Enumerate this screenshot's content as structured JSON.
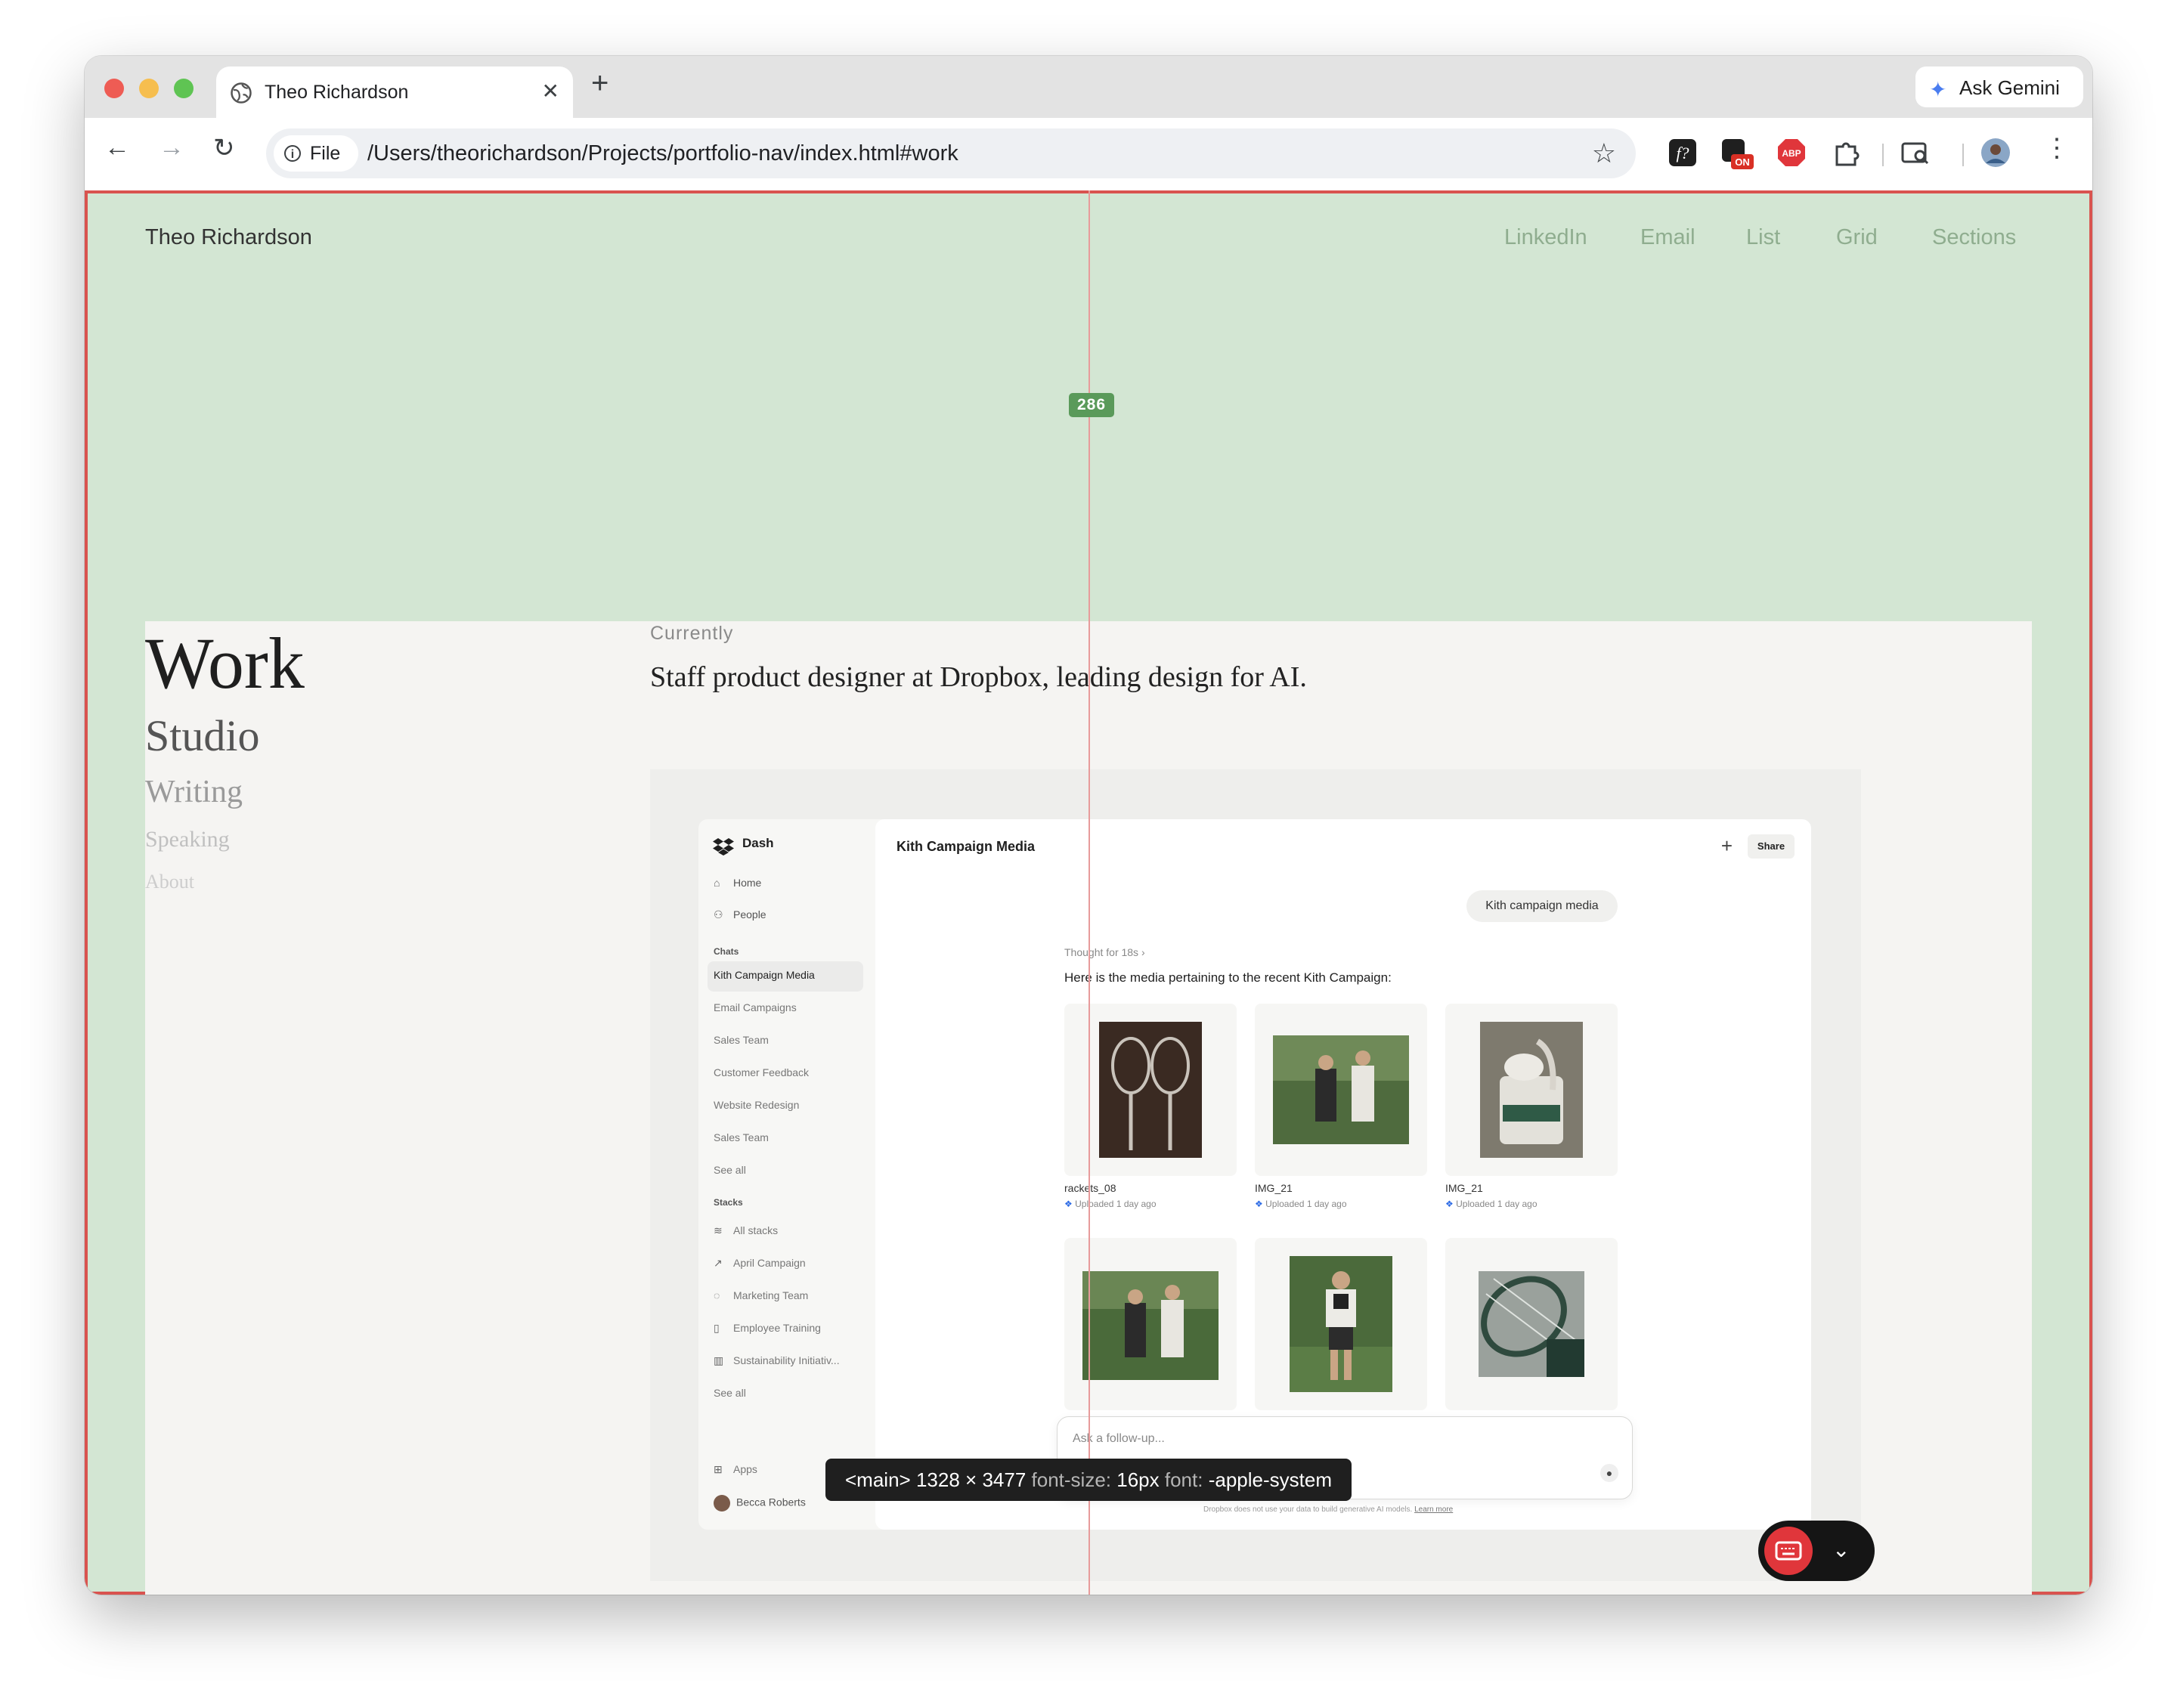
{
  "browser": {
    "tab_title": "Theo Richardson",
    "tab_close": "✕",
    "new_tab": "+",
    "gemini_label": "Ask Gemini",
    "back": "←",
    "forward": "→",
    "reload": "↻",
    "chip_label": "File",
    "url": "/Users/theorichardson/Projects/portfolio-nav/index.html#work",
    "ext_on_badge": "ON",
    "ext_abp": "ABP"
  },
  "site": {
    "name": "Theo Richardson",
    "nav": [
      "LinkedIn",
      "Email",
      "List",
      "Grid",
      "Sections"
    ]
  },
  "overlay": {
    "measure_value": "286",
    "inspector_tag": "<main>",
    "inspector_size": "1328 × 3477",
    "inspector_fs_label": "font-size:",
    "inspector_fs": "16px",
    "inspector_font_label": "font:",
    "inspector_font": "-apple-system"
  },
  "sidebar": {
    "items": [
      "Work",
      "Studio",
      "Writing",
      "Speaking",
      "About"
    ]
  },
  "main": {
    "eyebrow": "Currently",
    "role": "Staff product designer at Dropbox, leading design for AI."
  },
  "dash": {
    "brand": "Dash",
    "nav": [
      "Home",
      "People"
    ],
    "chats_heading": "Chats",
    "chats": [
      "Kith Campaign Media",
      "Email Campaigns",
      "Sales Team",
      "Customer Feedback",
      "Website Redesign",
      "Sales Team",
      "See all"
    ],
    "stacks_heading": "Stacks",
    "stacks": [
      "All stacks",
      "April Campaign",
      "Marketing Team",
      "Employee Training",
      "Sustainability Initiativ...",
      "See all"
    ],
    "apps": "Apps",
    "user": "Becca Roberts",
    "title": "Kith Campaign Media",
    "share": "Share",
    "user_message": "Kith campaign media",
    "thought": "Thought for 18s",
    "answer": "Here is the media pertaining to the recent Kith Campaign:",
    "media": [
      {
        "name": "rackets_08",
        "meta": "Uploaded 1 day ago"
      },
      {
        "name": "IMG_21",
        "meta": "Uploaded 1 day ago"
      },
      {
        "name": "IMG_21",
        "meta": "Uploaded 1 day ago"
      }
    ],
    "ask_placeholder": "Ask a follow-up...",
    "disclaimer": "Dropbox does not use your data to build generative AI models.",
    "learn_more": "Learn more"
  }
}
